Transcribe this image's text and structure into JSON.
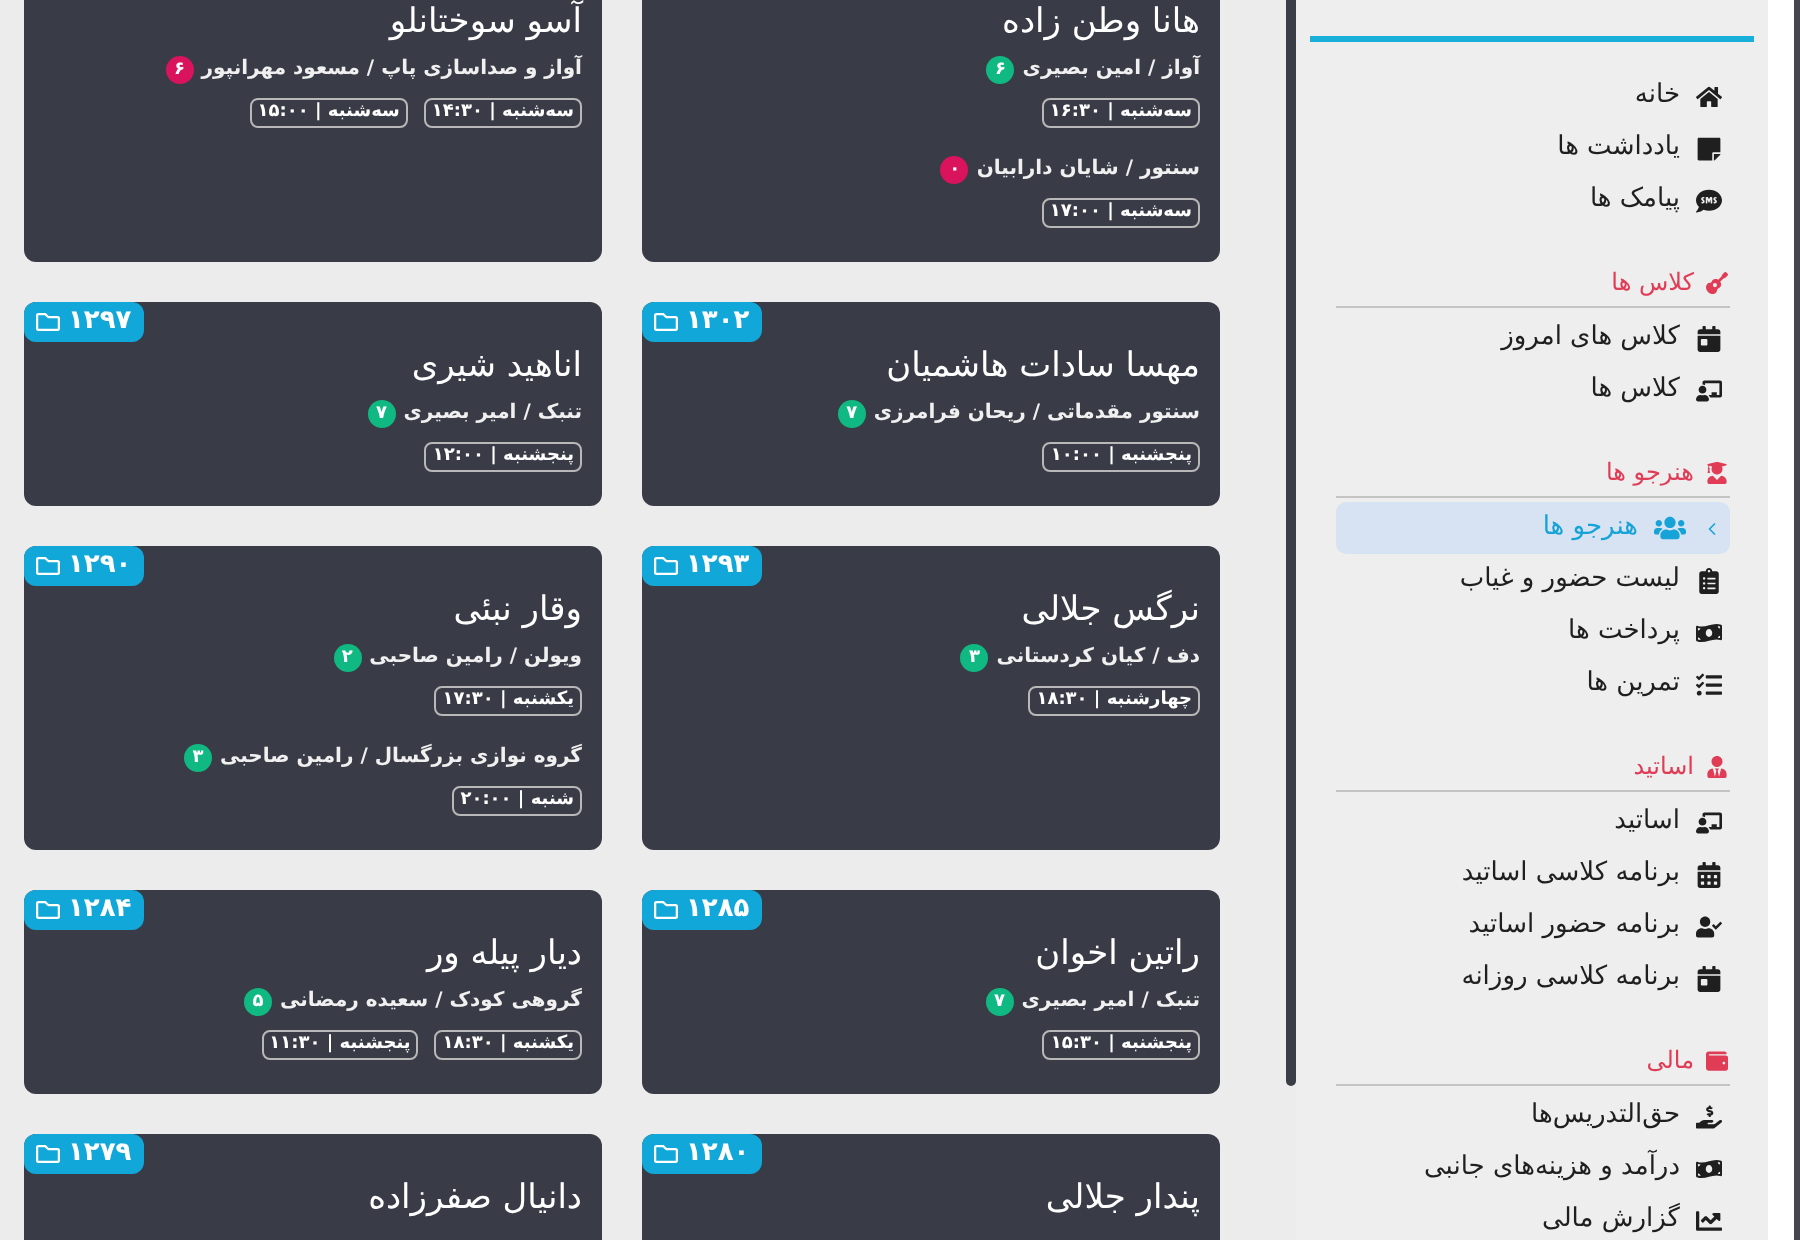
{
  "cards": [
    {
      "name": "هانا وطن زاده",
      "classes": [
        {
          "title": "آواز / امین بصیری",
          "count": "۶",
          "color": "#10b981",
          "times": [
            "سه‌شنبه | ۱۶:۳۰"
          ]
        },
        {
          "title": "سنتور / شایان دارابیان",
          "count": "۰",
          "color": "#d9135c",
          "times": [
            "سه‌شنبه | ۱۷:۰۰"
          ]
        }
      ]
    },
    {
      "name": "آسو سوختانلو",
      "classes": [
        {
          "title": "آواز و صداسازی پاپ / مسعود مهرانپور",
          "count": "۶",
          "color": "#d9135c",
          "times": [
            "سه‌شنبه | ۱۴:۳۰",
            "سه‌شنبه | ۱۵:۰۰"
          ]
        }
      ]
    },
    {
      "code": "۱۳۰۲",
      "name": "مهسا سادات هاشمیان",
      "classes": [
        {
          "title": "سنتور مقدماتی / ریحان فرامرزی",
          "count": "۷",
          "color": "#10b981",
          "times": [
            "پنجشنبه | ۱۰:۰۰"
          ]
        }
      ]
    },
    {
      "code": "۱۲۹۷",
      "name": "اناهید شیری",
      "classes": [
        {
          "title": "تنبک / امیر بصیری",
          "count": "۷",
          "color": "#10b981",
          "times": [
            "پنجشنبه | ۱۲:۰۰"
          ]
        }
      ]
    },
    {
      "code": "۱۲۹۳",
      "name": "نرگس جلالی",
      "classes": [
        {
          "title": "دف / کیان کردستانی",
          "count": "۳",
          "color": "#10b981",
          "times": [
            "چهارشنبه | ۱۸:۳۰"
          ]
        }
      ]
    },
    {
      "code": "۱۲۹۰",
      "name": "وقار نبئی",
      "classes": [
        {
          "title": "ویولن / رامین صاحبی",
          "count": "۲",
          "color": "#10b981",
          "times": [
            "یکشنبه | ۱۷:۳۰"
          ]
        },
        {
          "title": "گروه نوازی بزرگسال / رامین صاحبی",
          "count": "۳",
          "color": "#10b981",
          "times": [
            "شنبه | ۲۰:۰۰"
          ]
        }
      ]
    },
    {
      "code": "۱۲۸۵",
      "name": "راتین اخوان",
      "classes": [
        {
          "title": "تنبک / امیر بصیری",
          "count": "۷",
          "color": "#10b981",
          "times": [
            "پنجشنبه | ۱۵:۳۰"
          ]
        }
      ]
    },
    {
      "code": "۱۲۸۴",
      "name": "دیار پیله ور",
      "classes": [
        {
          "title": "گروهی کودک / سعیده رمضانی",
          "count": "۵",
          "color": "#10b981",
          "times": [
            "یکشنبه | ۱۸:۳۰",
            "پنجشنبه | ۱۱:۳۰"
          ]
        }
      ]
    },
    {
      "code": "۱۲۸۰",
      "name": "پندار جلالی"
    },
    {
      "code": "۱۲۷۹",
      "name": "دانیال صفرزاده"
    }
  ],
  "sidebar": {
    "top_items": [
      {
        "label": "خانه",
        "selected": false
      },
      {
        "label": "یادداشت ها",
        "selected": false
      },
      {
        "label": "پیامک ها",
        "selected": false
      }
    ],
    "sections": [
      {
        "title": "کلاس ها",
        "items": [
          {
            "label": "کلاس های امروز",
            "selected": false
          },
          {
            "label": "کلاس ها",
            "selected": false
          }
        ]
      },
      {
        "title": "هنرجو ها",
        "items": [
          {
            "label": "هنرجو ها",
            "selected": true
          },
          {
            "label": "لیست حضور و غیاب",
            "selected": false
          },
          {
            "label": "پرداخت ها",
            "selected": false
          },
          {
            "label": "تمرین ها",
            "selected": false
          }
        ]
      },
      {
        "title": "اساتید",
        "items": [
          {
            "label": "اساتید",
            "selected": false
          },
          {
            "label": "برنامه کلاسی اساتید",
            "selected": false
          },
          {
            "label": "برنامه حضور اساتید",
            "selected": false
          },
          {
            "label": "برنامه کلاسی روزانه",
            "selected": false
          }
        ]
      },
      {
        "title": "مالی",
        "items": [
          {
            "label": "حق‌التدریس‌ها",
            "selected": false
          },
          {
            "label": "درآمد و هزینه‌های جانبی",
            "selected": false
          },
          {
            "label": "گزارش مالی",
            "selected": false
          }
        ]
      }
    ]
  }
}
